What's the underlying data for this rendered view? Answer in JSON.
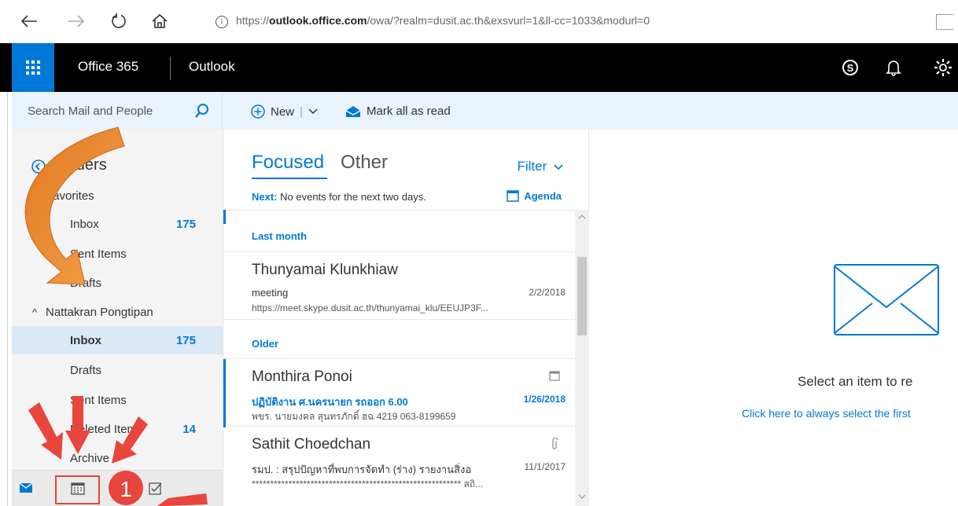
{
  "browser": {
    "url_prefix": "https://",
    "url_host": "outlook.office.com",
    "url_path": "/owa/?realm=dusit.ac.th&exsvurl=1&ll-cc=1033&modurl=0"
  },
  "suite": {
    "brand": "Office 365",
    "app": "Outlook"
  },
  "search": {
    "placeholder": "Search Mail and People"
  },
  "commands": {
    "new_label": "New",
    "mark_all_read": "Mark all as read"
  },
  "nav": {
    "folders_title": "Folders",
    "favorites": {
      "label": "Favorites",
      "items": [
        {
          "label": "Inbox",
          "count": "175"
        },
        {
          "label": "Sent Items",
          "count": ""
        },
        {
          "label": "Drafts",
          "count": ""
        }
      ]
    },
    "account": {
      "label": "Nattakran Pongtipan",
      "items": [
        {
          "label": "Inbox",
          "count": "175"
        },
        {
          "label": "Drafts",
          "count": ""
        },
        {
          "label": "Sent Items",
          "count": ""
        },
        {
          "label": "Deleted Items",
          "count": "14"
        },
        {
          "label": "Archive",
          "count": ""
        }
      ]
    }
  },
  "list": {
    "focused": "Focused",
    "other": "Other",
    "filter": "Filter",
    "next_label": "Next:",
    "next_text": "No events for the next two days.",
    "agenda": "Agenda",
    "groups": [
      "Last month",
      "Older"
    ],
    "messages": [
      {
        "sender": "Thunyamai Klunkhiaw",
        "subject": "meeting",
        "date": "2/2/2018",
        "preview": "https://meet.skype.dusit.ac.th/thunyamai_klu/EEUJP3F..."
      },
      {
        "sender": "Monthira Ponoi",
        "subject": "ปฏิบัติงาน ศ.นครนายก รถออก 6.00",
        "date": "1/26/2018",
        "preview": "พขร. นายมงคล สุนทรภักดิ์ ฮฉ 4219 063-8199659"
      },
      {
        "sender": "Sathit Choedchan",
        "subject": "รมป. : สรุปปัญหาที่พบการจัดทำ (ร่าง) รายงานสิ่งอ",
        "date": "11/1/2017",
        "preview": "********************************************************* สถิ..."
      }
    ]
  },
  "reading": {
    "empty_title": "Select an item to re",
    "empty_link": "Click here to always select the first"
  },
  "annotation": {
    "step_number": "1"
  },
  "colors": {
    "accent": "#0078d7",
    "suite_bg": "#000000",
    "arrow_red": "#e8453c",
    "arrow_orange": "#f39a3c"
  }
}
